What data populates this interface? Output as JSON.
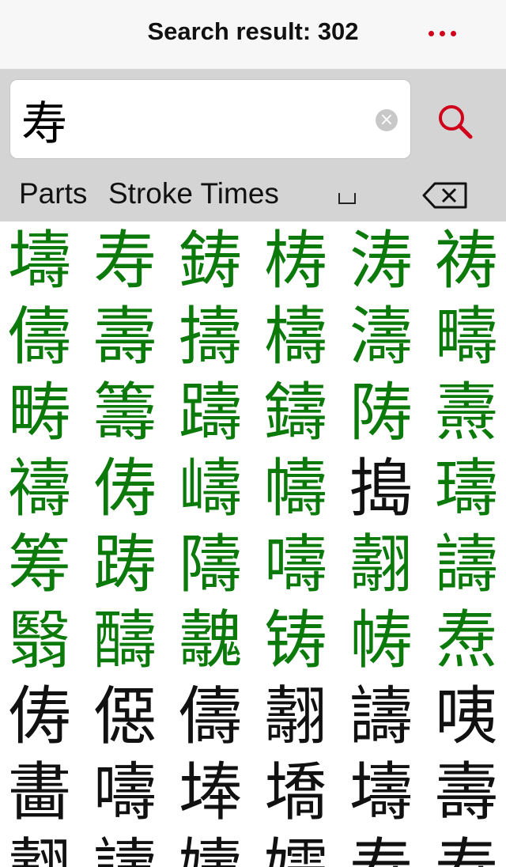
{
  "navbar": {
    "title": "Search result: 302",
    "more_icon": "more-dots-icon",
    "accent_color": "#d0021b"
  },
  "search": {
    "value": "寿",
    "clear_icon": "clear-icon",
    "search_icon": "search-icon"
  },
  "keys": {
    "parts": "Parts",
    "stroke_times": "Stroke Times",
    "space_icon": "space-icon",
    "backspace_icon": "backspace-icon"
  },
  "results": {
    "green_color": "#0b7a0b",
    "black_color": "#111111",
    "rows": [
      [
        {
          "c": "壔",
          "g": true
        },
        {
          "c": "寿",
          "g": true
        },
        {
          "c": "鋳",
          "g": true
        },
        {
          "c": "梼",
          "g": true
        },
        {
          "c": "涛",
          "g": true
        },
        {
          "c": "祷",
          "g": true
        }
      ],
      [
        {
          "c": "儔",
          "g": true
        },
        {
          "c": "壽",
          "g": true
        },
        {
          "c": "擣",
          "g": true
        },
        {
          "c": "檮",
          "g": true
        },
        {
          "c": "濤",
          "g": true
        },
        {
          "c": "疇",
          "g": true
        }
      ],
      [
        {
          "c": "畴",
          "g": true
        },
        {
          "c": "籌",
          "g": true
        },
        {
          "c": "躊",
          "g": true
        },
        {
          "c": "鑄",
          "g": true
        },
        {
          "c": "陦",
          "g": true
        },
        {
          "c": "燾",
          "g": true
        }
      ],
      [
        {
          "c": "禱",
          "g": true
        },
        {
          "c": "俦",
          "g": true
        },
        {
          "c": "嶹",
          "g": true
        },
        {
          "c": "幬",
          "g": true
        },
        {
          "c": "搗",
          "g": false
        },
        {
          "c": "璹",
          "g": true
        }
      ],
      [
        {
          "c": "筹",
          "g": true
        },
        {
          "c": "踌",
          "g": true
        },
        {
          "c": "隯",
          "g": true
        },
        {
          "c": "嚋",
          "g": true
        },
        {
          "c": "翿",
          "g": true
        },
        {
          "c": "譸",
          "g": true
        }
      ],
      [
        {
          "c": "翳",
          "g": true
        },
        {
          "c": "醻",
          "g": true
        },
        {
          "c": "魗",
          "g": true
        },
        {
          "c": "铸",
          "g": true
        },
        {
          "c": "帱",
          "g": true
        },
        {
          "c": "焘",
          "g": true
        }
      ],
      [
        {
          "c": "俦",
          "g": false
        },
        {
          "c": "僫",
          "g": false
        },
        {
          "c": "儔",
          "g": false
        },
        {
          "c": "翿",
          "g": false
        },
        {
          "c": "譸",
          "g": false
        },
        {
          "c": "咦",
          "g": false
        }
      ],
      [
        {
          "c": "畵",
          "g": false
        },
        {
          "c": "嚋",
          "g": false
        },
        {
          "c": "埲",
          "g": false
        },
        {
          "c": "墧",
          "g": false
        },
        {
          "c": "壔",
          "g": false
        },
        {
          "c": "壽",
          "g": false
        }
      ],
      [
        {
          "c": "翿",
          "g": false
        },
        {
          "c": "譸",
          "g": false
        },
        {
          "c": "嬦",
          "g": false
        },
        {
          "c": "嬬",
          "g": false
        },
        {
          "c": "寿",
          "g": false
        },
        {
          "c": "寿",
          "g": false
        }
      ]
    ]
  }
}
